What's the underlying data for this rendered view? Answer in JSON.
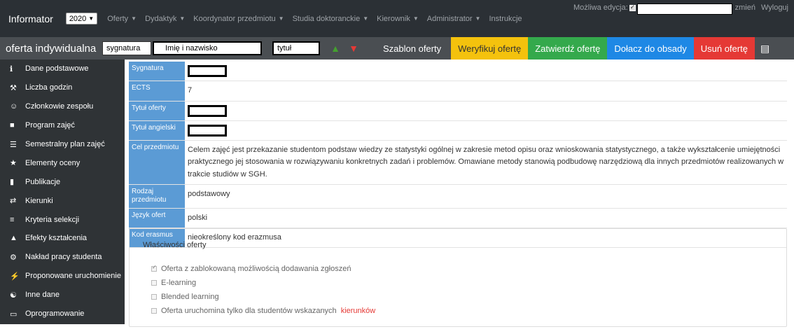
{
  "topnav": {
    "brand": "Informator",
    "year": "2020",
    "menu": [
      {
        "label": "Oferty"
      },
      {
        "label": "Dydaktyk"
      },
      {
        "label": "Koordynator przedmiotu"
      },
      {
        "label": "Studia doktoranckie"
      },
      {
        "label": "Kierownik"
      },
      {
        "label": "Administrator"
      },
      {
        "label": "Instrukcje"
      }
    ],
    "edit_label": "Możliwa edycja:",
    "change_link": "zmień",
    "logout_link": "Wyloguj"
  },
  "toolbar": {
    "title": "oferta indywidualna",
    "signature_input": "sygnatura",
    "name_input": "Imię i nazwisko",
    "title_input": "tytuł",
    "template_btn": "Szablon oferty",
    "verify_btn": "Weryfikuj ofertę",
    "approve_btn": "Zatwierdź ofertę",
    "join_btn": "Dołacz do obsady",
    "delete_btn": "Usuń ofertę",
    "colors": {
      "verify": "#f4c20d",
      "approve": "#34a94c",
      "join": "#1e88e5",
      "delete": "#e53935"
    }
  },
  "sidebar": {
    "items": [
      {
        "label": "Dane podstawowe",
        "icon": "info-icon"
      },
      {
        "label": "Liczba godzin",
        "icon": "gavel-icon"
      },
      {
        "label": "Członkowie zespołu",
        "icon": "users-icon"
      },
      {
        "label": "Program zajęć",
        "icon": "briefcase-icon"
      },
      {
        "label": "Semestralny plan zajęć",
        "icon": "list-icon"
      },
      {
        "label": "Elementy oceny",
        "icon": "star-icon"
      },
      {
        "label": "Publikacje",
        "icon": "book-icon"
      },
      {
        "label": "Kierunki",
        "icon": "exchange-icon"
      },
      {
        "label": "Kryteria selekcji",
        "icon": "sort-icon"
      },
      {
        "label": "Efekty kształcenia",
        "icon": "graduation-cap-icon"
      },
      {
        "label": "Nakład pracy studenta",
        "icon": "cogs-icon"
      },
      {
        "label": "Proponowane uruchomienie",
        "icon": "bolt-icon"
      },
      {
        "label": "Inne dane",
        "icon": "handshake-icon"
      },
      {
        "label": "Oprogramowanie",
        "icon": "monitor-icon"
      }
    ]
  },
  "details": {
    "rows": [
      {
        "label": "Sygnatura",
        "value": ""
      },
      {
        "label": "ECTS",
        "value": "7"
      },
      {
        "label": "Tytuł oferty",
        "value": ""
      },
      {
        "label": "Tytuł angielski",
        "value": ""
      },
      {
        "label": "Cel przedmiotu",
        "value": "Celem zajęć jest przekazanie studentom podstaw wiedzy ze statystyki ogólnej w zakresie metod opisu oraz wnioskowania statystycznego, a także wykształcenie umiejętności praktycznego jej stosowania w rozwiązywaniu konkretnych zadań i problemów. Omawiane metody stanowią podbudowę narzędziową dla innych przedmiotów realizowanych w trakcie studiów w SGH."
      },
      {
        "label": "Rodzaj przedmiotu",
        "value": "podstawowy"
      },
      {
        "label": "Język ofert",
        "value": "polski"
      },
      {
        "label": "Kod erasmus",
        "value": "nieokreślony kod erazmusa"
      }
    ],
    "label_color": "#5b9bd5"
  },
  "properties": {
    "title": "Właściwości oferty",
    "items": [
      {
        "label": "Oferta z zablokowaną możliwością dodawania zgłoszeń",
        "checked": true
      },
      {
        "label": "E-learning",
        "checked": false
      },
      {
        "label": "Blended learning",
        "checked": false
      },
      {
        "label": "Oferta uruchomina tylko dla studentów wskazanych",
        "checked": false,
        "link": "kierunków"
      }
    ]
  }
}
